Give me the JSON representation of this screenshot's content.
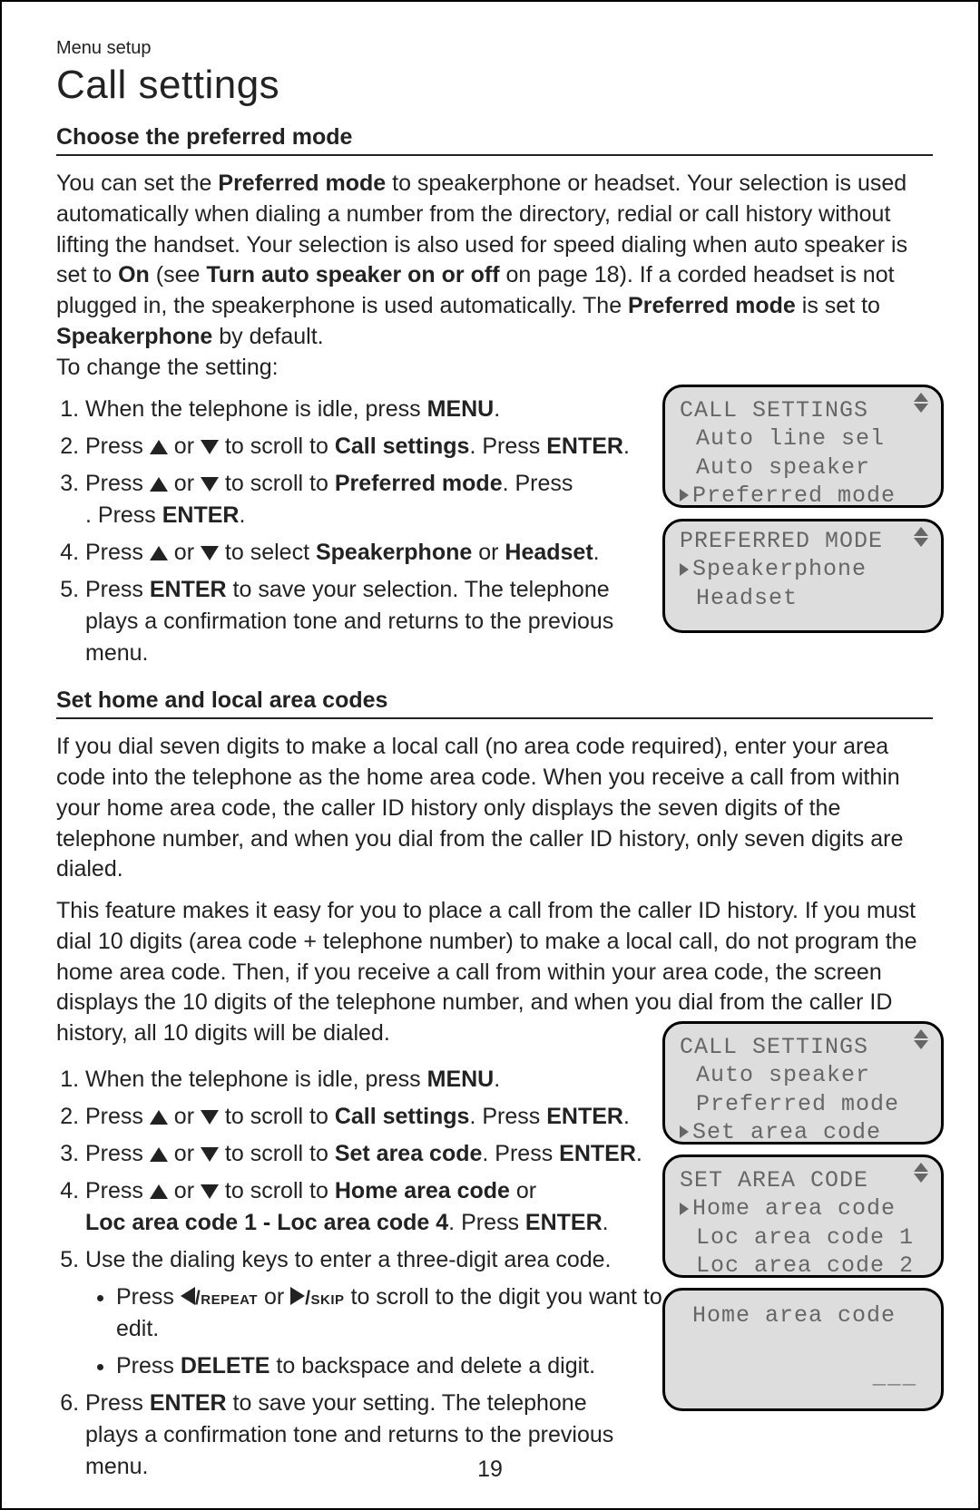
{
  "crumb": "Menu setup",
  "title": "Call settings",
  "section1": {
    "heading": "Choose the preferred mode",
    "para_parts": {
      "p1a": "You can set the ",
      "p1b": "Preferred mode",
      "p1c": " to speakerphone or headset. Your selection is used automatically when dialing a number from the directory, redial or call history without lifting the handset. Your selection is also used for speed dialing when auto speaker is set to ",
      "p1d": "On",
      "p1e": " (see ",
      "p1f": "Turn auto speaker on or off",
      "p1g": " on page 18). If a corded headset is not plugged in, the speakerphone is used automatically. The ",
      "p1h": "Preferred mode",
      "p1i": " is set to ",
      "p1j": "Speakerphone",
      "p1k": " by default.",
      "p1_line2": "To change the setting:"
    },
    "steps": {
      "s1a": "When the telephone is idle, press ",
      "s1b": "MENU",
      "s1c": ".",
      "s2a": "Press ",
      "s2b": " or ",
      "s2c": " to scroll to ",
      "s2d": "Call settings",
      "s2e": ". Press ",
      "s2f": "ENTER",
      "s2g": ".",
      "s3a": "Press ",
      "s3b": " or ",
      "s3c": " to scroll to ",
      "s3d": "Preferred mode",
      "s3e": ". Press ",
      "s3f": "ENTER",
      "s3g": ".",
      "s4a": "Press ",
      "s4b": " or ",
      "s4c": " to select ",
      "s4d": "Speakerphone",
      "s4e": " or ",
      "s4f": "Headset",
      "s4g": ".",
      "s5a": "Press ",
      "s5b": "ENTER",
      "s5c": " to save your selection. The telephone plays a confirmation tone and returns to the previous menu."
    }
  },
  "section2": {
    "heading": "Set home and local area codes",
    "para1": "If you dial seven digits to make a local call (no area code required), enter your area code into the telephone as the home area code. When you receive a call from within your home area code, the caller ID history only displays the seven digits of the telephone number, and when you dial from the caller ID history, only seven digits are dialed.",
    "para2": "This feature makes it easy for you to place a call from the caller ID history. If you must dial 10 digits (area code + telephone number) to make a local call, do not program the home area code. Then, if you receive a call from within your area code, the screen displays the 10 digits of the telephone number, and when you dial from the caller ID history, all 10 digits will be dialed.",
    "steps": {
      "s1a": "When the telephone is idle, press ",
      "s1b": "MENU",
      "s1c": ".",
      "s2a": "Press ",
      "s2b": " or ",
      "s2c": " to scroll to ",
      "s2d": "Call settings",
      "s2e": ". Press ",
      "s2f": "ENTER",
      "s2g": ".",
      "s3a": "Press ",
      "s3b": " or ",
      "s3c": " to scroll to ",
      "s3d": "Set area code",
      "s3e": ". Press ",
      "s3f": "ENTER",
      "s3g": ".",
      "s4a": "Press ",
      "s4b": " or ",
      "s4c": " to scroll to ",
      "s4d": "Home area code",
      "s4e": " or ",
      "s4f": "Loc area code 1 - Loc area code 4",
      "s4g": ". Press ",
      "s4h": "ENTER",
      "s4i": ".",
      "s5": "Use the dialing keys to enter a three-digit area code.",
      "s5b1a": "Press ",
      "s5b1b": "/repeat",
      "s5b1c": " or ",
      "s5b1d": "/skip",
      "s5b1e": " to scroll to the digit you want to edit.",
      "s5b2a": "Press ",
      "s5b2b": "DELETE",
      "s5b2c": " to backspace and delete a digit.",
      "s6a": "Press ",
      "s6b": "ENTER",
      "s6c": " to save your setting. The telephone plays a confirmation tone and returns to the previous menu."
    }
  },
  "screens": {
    "call_settings_1": {
      "title": "CALL SETTINGS",
      "row1": "Auto line sel",
      "row2": "Auto speaker",
      "row3": "Preferred mode"
    },
    "preferred_mode": {
      "title": "PREFERRED MODE",
      "row1": "Speakerphone",
      "row2": "Headset"
    },
    "call_settings_2": {
      "title": "CALL SETTINGS",
      "row1": "Auto speaker",
      "row2": "Preferred mode",
      "row3": "Set area code"
    },
    "set_area_code": {
      "title": "SET AREA CODE",
      "row1": "Home area code",
      "row2": "Loc area code 1",
      "row3": "Loc area code 2"
    },
    "home_area_code": {
      "title": "Home area code",
      "dashes": "___"
    }
  },
  "page_number": "19"
}
